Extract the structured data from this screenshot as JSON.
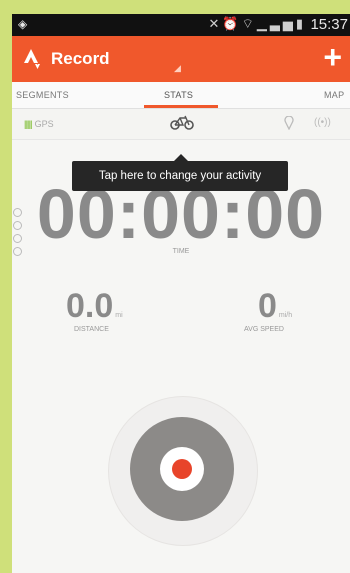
{
  "status_bar": {
    "time": "15:37",
    "icons": [
      "wifi-icon",
      "mute-icon",
      "alarm-icon",
      "signal-icon",
      "battery-icon"
    ]
  },
  "app_bar": {
    "title": "Record",
    "plus_label": "+",
    "accent_color": "#f0582c"
  },
  "tabs": [
    {
      "label": "SEGMENTS"
    },
    {
      "label": "STATS",
      "selected": true
    },
    {
      "label": "MAP"
    }
  ],
  "sensors": {
    "gps_label": "GPS"
  },
  "tooltip": {
    "text": "Tap here to change your activity"
  },
  "timer": {
    "value": "00:00:00",
    "label": "TIME"
  },
  "stats": {
    "distance": {
      "value": "0.0",
      "unit": "mi",
      "label": "DISTANCE"
    },
    "avg_speed": {
      "value": "0",
      "unit": "mi/h",
      "label": "AVG SPEED"
    }
  },
  "record_button": {
    "color": "#e8442a"
  }
}
